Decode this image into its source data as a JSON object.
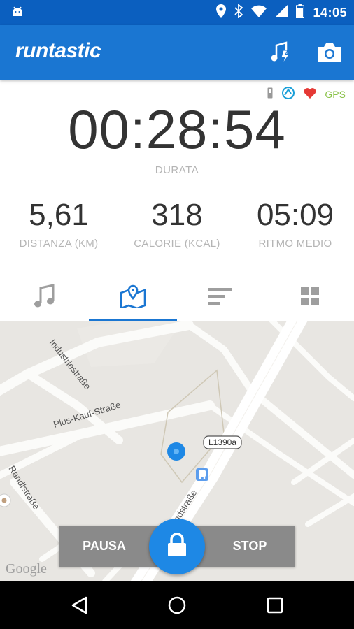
{
  "status_bar": {
    "time": "14:05",
    "icons": [
      "android-icon",
      "location-icon",
      "bluetooth-icon",
      "wifi-icon",
      "signal-icon",
      "battery-icon"
    ]
  },
  "app_bar": {
    "logo": "runtastic",
    "actions": [
      "music-power-song-icon",
      "camera-icon"
    ]
  },
  "session": {
    "indicators": [
      "phone-icon",
      "sensor-icon",
      "heart-icon"
    ],
    "gps_label": "GPS",
    "duration": "00:28:54",
    "duration_label": "DURATA",
    "metrics": [
      {
        "value": "5,61",
        "label": "DISTANZA (KM)"
      },
      {
        "value": "318",
        "label": "CALORIE (KCAL)"
      },
      {
        "value": "05:09",
        "label": "RITMO MEDIO"
      }
    ]
  },
  "tabs": [
    {
      "name": "music",
      "icon": "music-note-icon",
      "active": false
    },
    {
      "name": "map",
      "icon": "map-icon",
      "active": true
    },
    {
      "name": "graphs",
      "icon": "bars-icon",
      "active": false
    },
    {
      "name": "dashboard",
      "icon": "grid-icon",
      "active": false
    }
  ],
  "map": {
    "streets": [
      "Industriestraße",
      "Plus-Kauf-Straße",
      "Randlstraße",
      "Landstraße"
    ],
    "road_badge": "L1390a",
    "attribution": "Google"
  },
  "controls": {
    "pause_label": "PAUSA",
    "stop_label": "STOP"
  },
  "colors": {
    "primary": "#1a76d2",
    "status_bar": "#0b5fbf",
    "gps": "#8bc34a",
    "heart": "#e53935",
    "controls_bg": "#8a8a8a"
  }
}
